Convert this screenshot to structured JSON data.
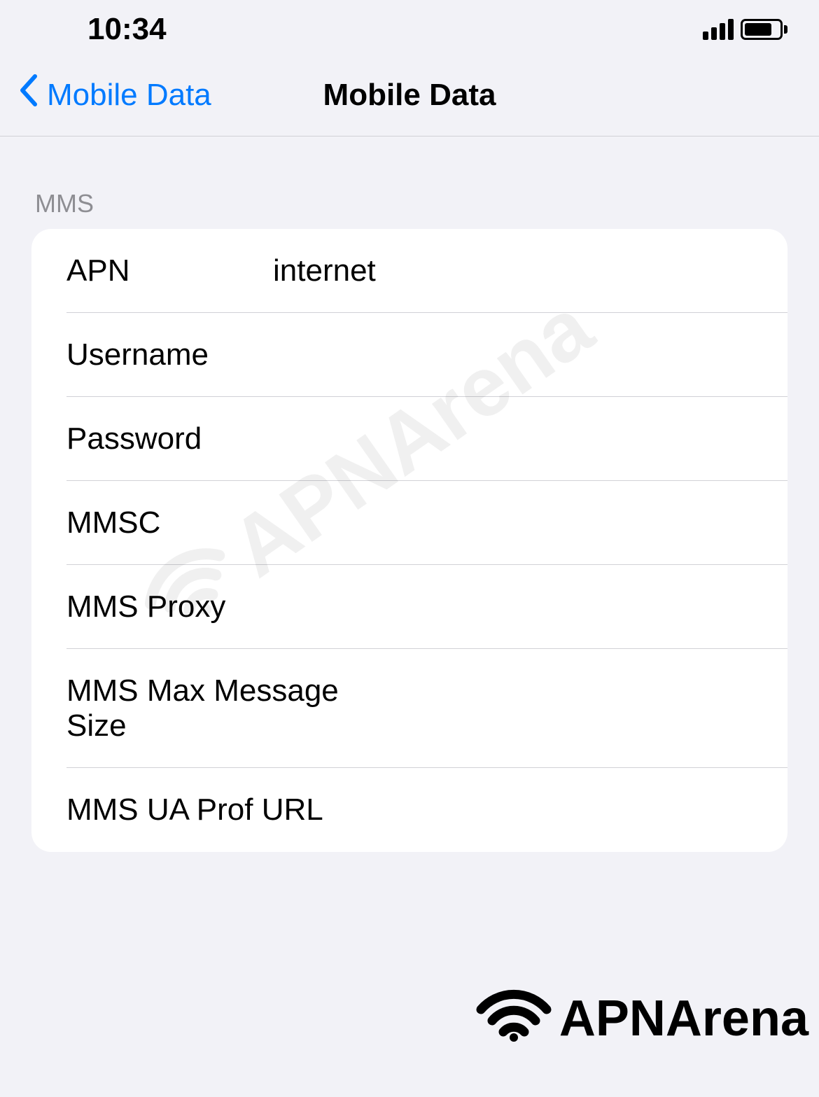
{
  "statusBar": {
    "time": "10:34"
  },
  "nav": {
    "backLabel": "Mobile Data",
    "title": "Mobile Data"
  },
  "sectionHeader": "MMS",
  "fields": {
    "apn": {
      "label": "APN",
      "value": "internet"
    },
    "username": {
      "label": "Username",
      "value": ""
    },
    "password": {
      "label": "Password",
      "value": ""
    },
    "mmsc": {
      "label": "MMSC",
      "value": ""
    },
    "mmsProxy": {
      "label": "MMS Proxy",
      "value": ""
    },
    "mmsMaxMsg": {
      "label": "MMS Max Message Size",
      "value": ""
    },
    "mmsUaProf": {
      "label": "MMS UA Prof URL",
      "value": ""
    }
  },
  "watermark": "APNArena",
  "footerBrand": "APNArena"
}
